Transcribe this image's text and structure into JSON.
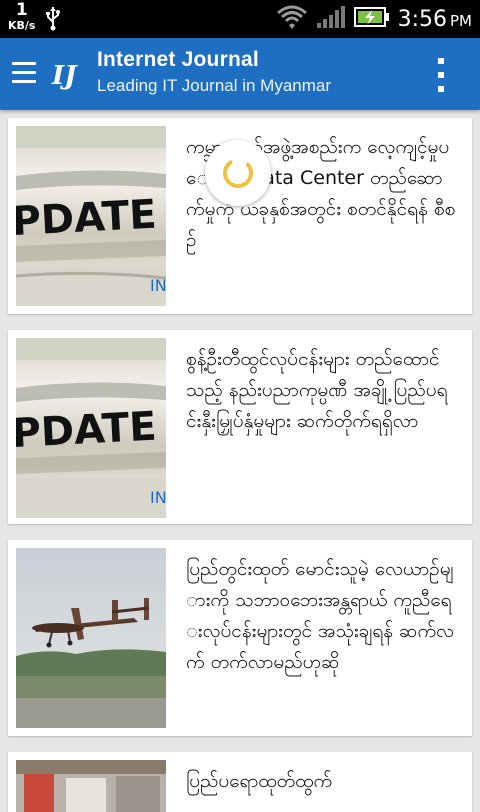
{
  "status_bar": {
    "speed_value": "1",
    "speed_unit": "KB/s",
    "time": "3:56",
    "ampm": "PM",
    "icons": [
      "usb-icon",
      "wifi-icon",
      "signal-icon",
      "battery-charging-icon"
    ]
  },
  "app_bar": {
    "title": "Internet Journal",
    "subtitle": "Leading IT Journal in Myanmar",
    "logo_text": "IJ",
    "color": "#1e6fc2"
  },
  "articles": [
    {
      "title": "ကမ္ဘာ့ကျော်အဖွဲ့အစည်းက လေ့ကျင့်မှုပေးမည့် Data Center တည်ဆောက်မှုကို ယခုနှစ်အတွင်း စတင်နိုင်ရန် စီစဉ်",
      "thumb_text": "PDATE N",
      "thumb_brand": "IN"
    },
    {
      "title": "စွန့်ဦးတီထွင်လုပ်ငန်းများ တည်ထောင်သည့် နည်းပညာကုမ္ပဏီ အချို့ ပြည်ပရင်းနှီးမြှုပ်နှံမှုများ ဆက်တိုက်ရရှိလာ",
      "thumb_text": "PDATE N",
      "thumb_brand": "IN"
    },
    {
      "title": "ပြည်တွင်းထုတ် မောင်းသူမဲ့ လေယာဉ်များကို သဘာဝဘေးအန္တရာယ် ကူညီရေးလုပ်ငန်းများတွင် အသုံးချရန် ဆက်လက် တက်လာမည်ဟုဆို",
      "thumb_text": "",
      "thumb_brand": ""
    },
    {
      "title": "ပြည်ပရောထုတ်ထွက်",
      "thumb_text": "",
      "thumb_brand": ""
    }
  ],
  "loading_indicator": "spinner"
}
